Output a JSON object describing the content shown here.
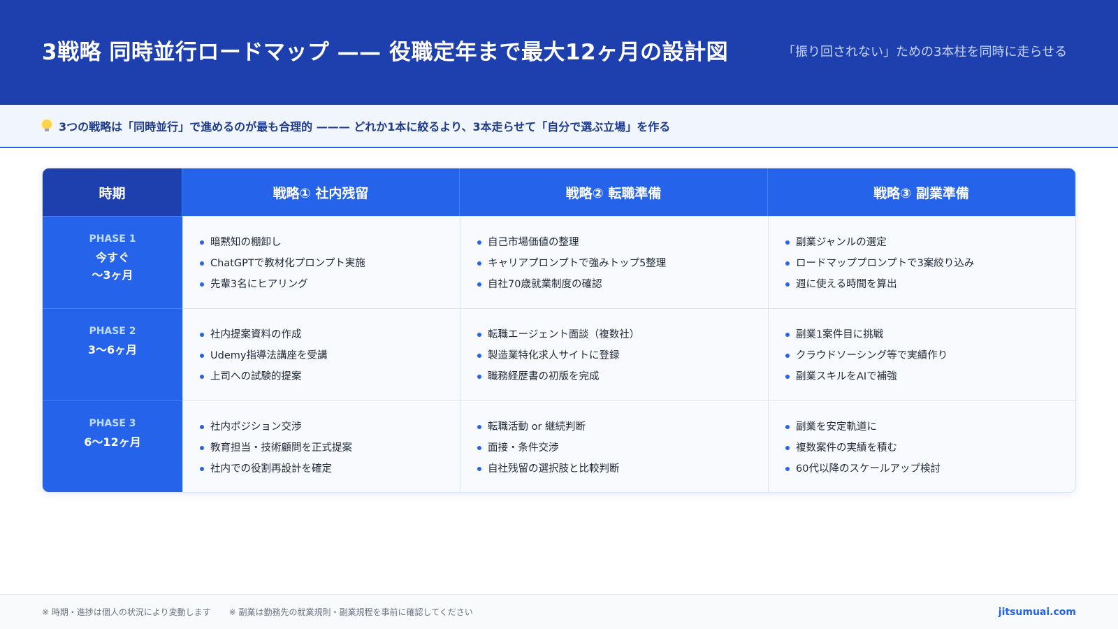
{
  "header": {
    "title": "3戦略 同時並行ロードマップ —— 役職定年まで最大12ヶ月の設計図",
    "subtitle": "「振り回されない」ための3本柱を同時に走らせる"
  },
  "callout": {
    "icon": "lightbulb-icon",
    "text": "3つの戦略は「同時並行」で進めるのが最も合理的 ——— どれか1本に絞るより、3本走らせて「自分で選ぶ立場」を作る"
  },
  "table": {
    "headers": {
      "period": "時期",
      "strategy1": "戦略① 社内残留",
      "strategy2": "戦略② 転職準備",
      "strategy3": "戦略③ 副業準備"
    },
    "rows": [
      {
        "phase": "PHASE 1",
        "range_line1": "今すぐ",
        "range_line2": "〜3ヶ月",
        "s1": [
          "暗黙知の棚卸し",
          "ChatGPTで教材化プロンプト実施",
          "先輩3名にヒアリング"
        ],
        "s2": [
          "自己市場価値の整理",
          "キャリアプロンプトで強みトップ5整理",
          "自社70歳就業制度の確認"
        ],
        "s3": [
          "副業ジャンルの選定",
          "ロードマッププロンプトで3案絞り込み",
          "週に使える時間を算出"
        ]
      },
      {
        "phase": "PHASE 2",
        "range_line1": "3〜6ヶ月",
        "range_line2": "",
        "s1": [
          "社内提案資料の作成",
          "Udemy指導法講座を受講",
          "上司への試験的提案"
        ],
        "s2": [
          "転職エージェント面談（複数社）",
          "製造業特化求人サイトに登録",
          "職務経歴書の初版を完成"
        ],
        "s3": [
          "副業1案件目に挑戦",
          "クラウドソーシング等で実績作り",
          "副業スキルをAIで補強"
        ]
      },
      {
        "phase": "PHASE 3",
        "range_line1": "6〜12ヶ月",
        "range_line2": "",
        "s1": [
          "社内ポジション交渉",
          "教育担当・技術顧問を正式提案",
          "社内での役割再設計を確定"
        ],
        "s2": [
          "転職活動 or 継続判断",
          "面接・条件交渉",
          "自社残留の選択肢と比較判断"
        ],
        "s3": [
          "副業を安定軌道に",
          "複数案件の実績を積む",
          "60代以降のスケールアップ検討"
        ]
      }
    ]
  },
  "footer": {
    "note1": "※ 時期・進捗は個人の状況により変動します",
    "note2": "※ 副業は勤務先の就業規則・副業規程を事前に確認してください",
    "brand": "jitsumuai.com"
  }
}
